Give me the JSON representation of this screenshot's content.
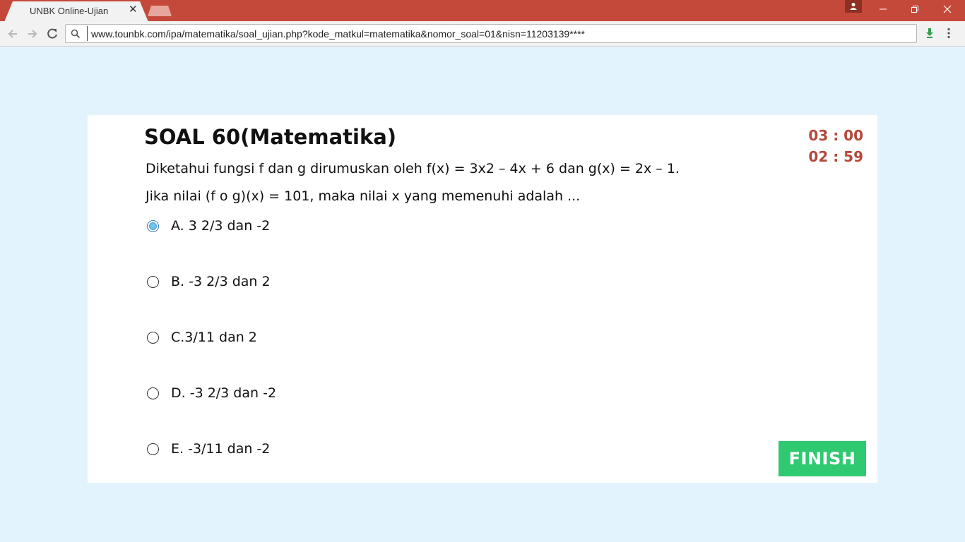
{
  "browser": {
    "tab_title": "UNBK Online-Ujian",
    "tab_close": "✕",
    "url": "www.tounbk.com/ipa/matematika/soal_ujian.php?kode_matkul=matematika&nomor_soal=01&nisn=11203139****"
  },
  "exam": {
    "title": "SOAL 60(Matematika)",
    "timer_total": "03 : 00",
    "timer_remaining": "02 : 59",
    "question_line1": "Diketahui fungsi f dan g dirumuskan oleh f(x) = 3x2 – 4x + 6 dan g(x) = 2x – 1.",
    "question_line2": "Jika nilai (f o g)(x) = 101, maka nilai x yang memenuhi adalah ...",
    "options": [
      {
        "label": "A. 3 2/3 dan -2",
        "selected": true
      },
      {
        "label": "B. -3 2/3 dan 2",
        "selected": false
      },
      {
        "label": "C.3/11 dan 2",
        "selected": false
      },
      {
        "label": "D. -3 2/3 dan -2",
        "selected": false
      },
      {
        "label": "E. -3/11 dan -2",
        "selected": false
      }
    ],
    "finish_label": "FINISH"
  },
  "colors": {
    "titlebar": "#c5493a",
    "page_bg": "#e3f3fd",
    "timer": "#b5483b",
    "finish": "#2ec971",
    "radio_selected": "#6ec3f0"
  }
}
